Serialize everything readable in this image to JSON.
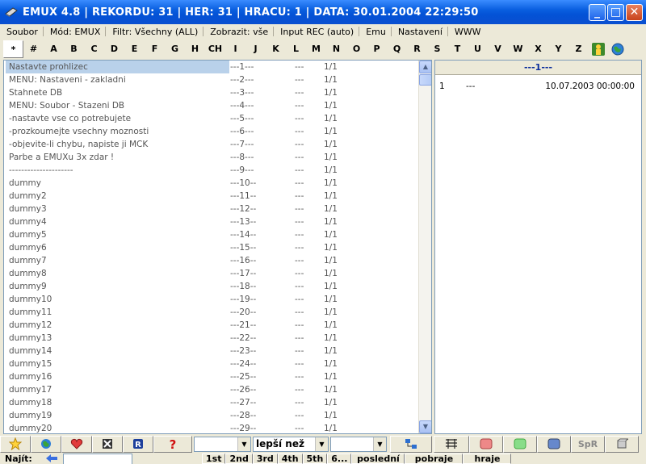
{
  "window": {
    "title": "EMUX 4.8  |  REKORDU: 31  |  HER: 31  |  HRACU: 1  |  DATA: 30.01.2004 22:29:50"
  },
  "menu": {
    "items": [
      {
        "label": "Soubor"
      },
      {
        "label": "Mód: EMUX"
      },
      {
        "label": "Filtr: Všechny  (ALL)"
      },
      {
        "label": "Zobrazit: vše"
      },
      {
        "label": "Input REC (auto)"
      },
      {
        "label": "Emu"
      },
      {
        "label": "Nastavení"
      },
      {
        "label": "WWW"
      }
    ]
  },
  "letters": [
    "*",
    "#",
    "A",
    "B",
    "C",
    "D",
    "E",
    "F",
    "G",
    "H",
    "CH",
    "I",
    "J",
    "K",
    "L",
    "M",
    "N",
    "O",
    "P",
    "Q",
    "R",
    "S",
    "T",
    "U",
    "V",
    "W",
    "X",
    "Y",
    "Z"
  ],
  "list": {
    "rows": [
      {
        "name": "Nastavte prohlizec",
        "idx": "---1---",
        "dash": "---",
        "frac": "1/1"
      },
      {
        "name": "MENU: Nastaveni - zakladni",
        "idx": "---2---",
        "dash": "---",
        "frac": "1/1"
      },
      {
        "name": "Stahnete DB",
        "idx": "---3---",
        "dash": "---",
        "frac": "1/1"
      },
      {
        "name": "MENU: Soubor - Stazeni DB",
        "idx": "---4---",
        "dash": "---",
        "frac": "1/1"
      },
      {
        "name": "-nastavte vse co potrebujete",
        "idx": "---5---",
        "dash": "---",
        "frac": "1/1"
      },
      {
        "name": "-prozkoumejte vsechny moznosti",
        "idx": "---6---",
        "dash": "---",
        "frac": "1/1"
      },
      {
        "name": "-objevite-li chybu, napiste ji MCK",
        "idx": "---7---",
        "dash": "---",
        "frac": "1/1"
      },
      {
        "name": "Parbe a EMUXu 3x zdar !",
        "idx": "---8---",
        "dash": "---",
        "frac": "1/1"
      },
      {
        "name": "---------------------",
        "idx": "---9---",
        "dash": "---",
        "frac": "1/1"
      },
      {
        "name": "dummy",
        "idx": "---10--",
        "dash": "---",
        "frac": "1/1"
      },
      {
        "name": "dummy2",
        "idx": "---11--",
        "dash": "---",
        "frac": "1/1"
      },
      {
        "name": "dummy3",
        "idx": "---12--",
        "dash": "---",
        "frac": "1/1"
      },
      {
        "name": "dummy4",
        "idx": "---13--",
        "dash": "---",
        "frac": "1/1"
      },
      {
        "name": "dummy5",
        "idx": "---14--",
        "dash": "---",
        "frac": "1/1"
      },
      {
        "name": "dummy6",
        "idx": "---15--",
        "dash": "---",
        "frac": "1/1"
      },
      {
        "name": "dummy7",
        "idx": "---16--",
        "dash": "---",
        "frac": "1/1"
      },
      {
        "name": "dummy8",
        "idx": "---17--",
        "dash": "---",
        "frac": "1/1"
      },
      {
        "name": "dummy9",
        "idx": "---18--",
        "dash": "---",
        "frac": "1/1"
      },
      {
        "name": "dummy10",
        "idx": "---19--",
        "dash": "---",
        "frac": "1/1"
      },
      {
        "name": "dummy11",
        "idx": "---20--",
        "dash": "---",
        "frac": "1/1"
      },
      {
        "name": "dummy12",
        "idx": "---21--",
        "dash": "---",
        "frac": "1/1"
      },
      {
        "name": "dummy13",
        "idx": "---22--",
        "dash": "---",
        "frac": "1/1"
      },
      {
        "name": "dummy14",
        "idx": "---23--",
        "dash": "---",
        "frac": "1/1"
      },
      {
        "name": "dummy15",
        "idx": "---24--",
        "dash": "---",
        "frac": "1/1"
      },
      {
        "name": "dummy16",
        "idx": "---25--",
        "dash": "---",
        "frac": "1/1"
      },
      {
        "name": "dummy17",
        "idx": "---26--",
        "dash": "---",
        "frac": "1/1"
      },
      {
        "name": "dummy18",
        "idx": "---27--",
        "dash": "---",
        "frac": "1/1"
      },
      {
        "name": "dummy19",
        "idx": "---28--",
        "dash": "---",
        "frac": "1/1"
      },
      {
        "name": "dummy20",
        "idx": "---29--",
        "dash": "---",
        "frac": "1/1"
      }
    ]
  },
  "detail": {
    "header": "---1---",
    "row": {
      "num": "1",
      "val": "---",
      "date": "10.07.2003 00:00:00"
    }
  },
  "toolbar": {
    "combo_compare": "lepší než",
    "spr_label": "SpR"
  },
  "search": {
    "label": "Najít:",
    "rank_buttons": [
      "1st",
      "2nd",
      "3rd",
      "4th",
      "5th",
      "6...",
      "poslední",
      "pobraje",
      "hraje"
    ]
  },
  "colors": {
    "titlebar": "#0a5fe0",
    "selection": "#b9d1ea",
    "list_border": "#7f9db9",
    "chrome": "#ece9d8"
  }
}
